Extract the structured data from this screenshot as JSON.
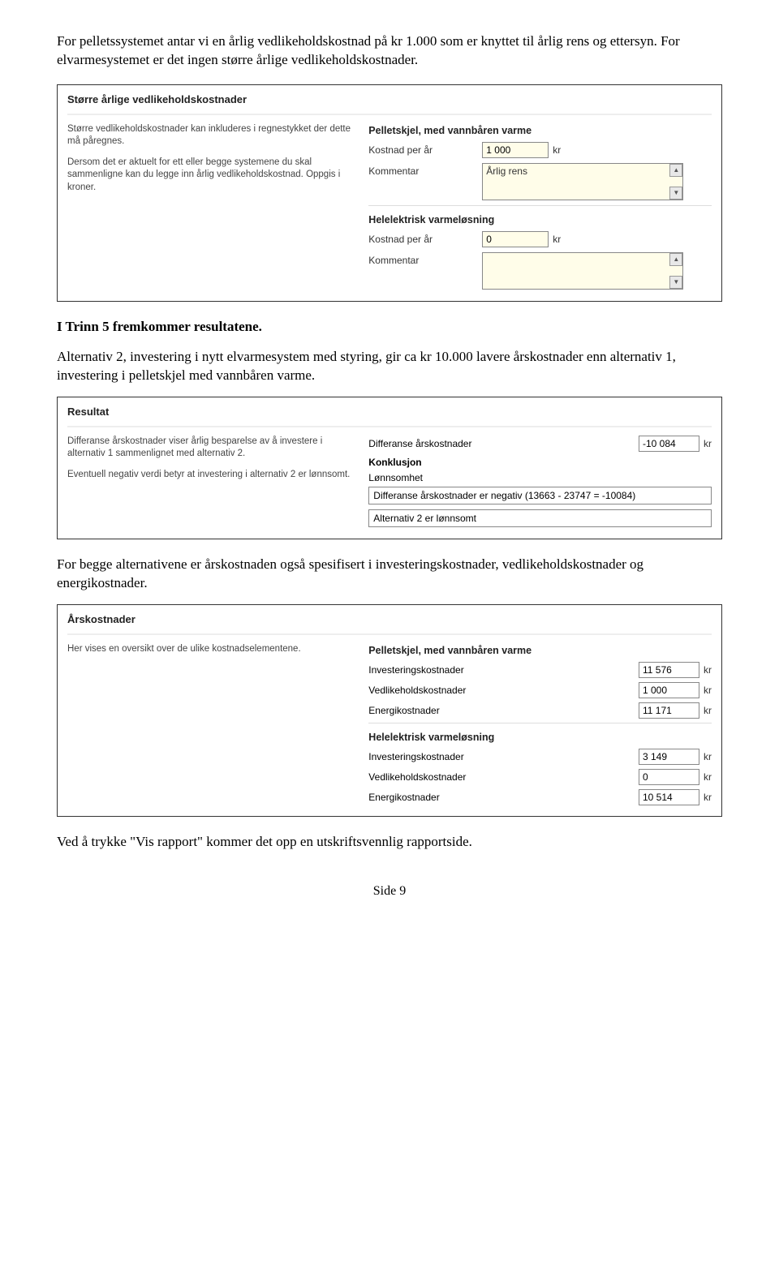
{
  "intro": "For pelletssystemet antar vi en årlig vedlikeholdskostnad på kr 1.000 som er knyttet til årlig rens og ettersyn. For elvarmesystemet er det ingen større årlige vedlikeholdskostnader.",
  "panel1": {
    "title": "Større årlige vedlikeholdskostnader",
    "left_p1": "Større vedlikeholdskostnader kan inkluderes i regnestykket der dette må påregnes.",
    "left_p2": "Dersom det er aktuelt for ett eller begge systemene du skal sammenligne kan du legge inn årlig vedlikeholdskostnad. Oppgis i kroner.",
    "sys1": {
      "heading": "Pelletskjel, med vannbåren varme",
      "cost_label": "Kostnad per år",
      "cost_value": "1 000",
      "unit": "kr",
      "comment_label": "Kommentar",
      "comment_value": "Årlig rens"
    },
    "sys2": {
      "heading": "Helelektrisk varmeløsning",
      "cost_label": "Kostnad per år",
      "cost_value": "0",
      "unit": "kr",
      "comment_label": "Kommentar",
      "comment_value": ""
    }
  },
  "mid_para1": "I Trinn 5 fremkommer resultatene.",
  "mid_para2": "Alternativ 2, investering i nytt elvarmesystem med styring, gir ca kr 10.000 lavere årskostnader enn alternativ 1, investering i pelletskjel med vannbåren varme.",
  "panel2": {
    "title": "Resultat",
    "left_p1": "Differanse årskostnader viser årlig besparelse av å investere i alternativ 1 sammenlignet med alternativ 2.",
    "left_p2": "Eventuell negativ verdi betyr at investering i alternativ 2 er lønnsomt.",
    "diff_label": "Differanse årskostnader",
    "diff_value": "-10 084",
    "unit": "kr",
    "konkl_title": "Konklusjon",
    "konkl_sub": "Lønnsomhet",
    "line1": "Differanse årskostnader er negativ (13663 - 23747 = -10084)",
    "line2": "Alternativ 2 er lønnsomt"
  },
  "mid_para3": "For begge alternativene er årskostnaden også spesifisert i investeringskostnader, vedlikeholdskostnader og energikostnader.",
  "panel3": {
    "title": "Årskostnader",
    "left_p1": "Her vises en oversikt over de ulike kostnadselementene.",
    "sys1": {
      "heading": "Pelletskjel, med vannbåren varme",
      "rows": [
        {
          "label": "Investeringskostnader",
          "value": "11 576",
          "unit": "kr"
        },
        {
          "label": "Vedlikeholdskostnader",
          "value": "1 000",
          "unit": "kr"
        },
        {
          "label": "Energikostnader",
          "value": "11 171",
          "unit": "kr"
        }
      ]
    },
    "sys2": {
      "heading": "Helelektrisk varmeløsning",
      "rows": [
        {
          "label": "Investeringskostnader",
          "value": "3 149",
          "unit": "kr"
        },
        {
          "label": "Vedlikeholdskostnader",
          "value": "0",
          "unit": "kr"
        },
        {
          "label": "Energikostnader",
          "value": "10 514",
          "unit": "kr"
        }
      ]
    }
  },
  "outro": "Ved å trykke \"Vis rapport\" kommer det opp en utskriftsvennlig rapportside.",
  "footer": "Side 9"
}
